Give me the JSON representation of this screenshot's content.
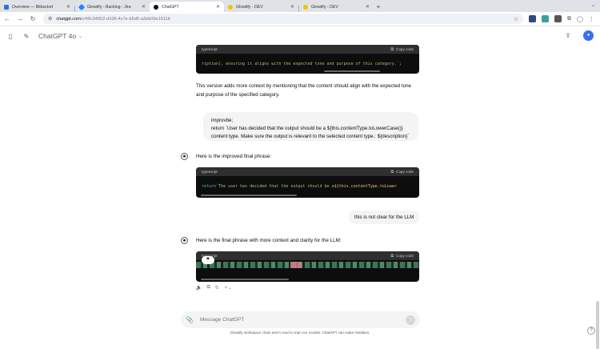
{
  "browser": {
    "tabs": [
      {
        "title": "Overview — Bitbucket",
        "color": "#2f6fe4"
      },
      {
        "title": "Glowtify - Backlog - Jira",
        "color": "#2684ff"
      },
      {
        "title": "ChatGPT",
        "color": "#111111"
      },
      {
        "title": "Glowtify - DEV",
        "color": "#f2c200"
      },
      {
        "title": "Glowtify - DEV",
        "color": "#f2c200"
      }
    ],
    "url_host": "chatgpt.com",
    "url_path": "/c/46c34052-d106-4c7e-b5d5-a3eb09e1511b"
  },
  "app": {
    "model": "ChatGPT 4o"
  },
  "conversation": {
    "code1": {
      "lang": "typescript",
      "copy_label": "Copy code",
      "line": "ription), ensuring it aligns with the expected tone and purpose of this category.`;"
    },
    "para1": "This version adds more context by mentioning that the content should align with the expected tone and purpose of the specified category.",
    "user1": {
      "line1": "improvbe;",
      "line2": "return `User has decided that the output should be a ${this.contentType.toLowerCase()}",
      "line3": "content type. Make sure the output is relevant to the selected content type.: ${description}`"
    },
    "asst2": "Here is the improved final phrase:",
    "code2": {
      "lang": "typescript",
      "copy_label": "Copy code",
      "kw": "return",
      "str": " `The user has decided that the output should be a ",
      "interp": "${this.contentType.toLower"
    },
    "user2": "this is not clear for the LLM",
    "asst3": "Here is the final phrase with more context and clarity for the LLM:",
    "code3": {
      "lang": "typescript",
      "copy_label": "Copy code"
    }
  },
  "composer": {
    "placeholder": "Message ChatGPT",
    "disclaimer": "Glowtify workspace chats aren't used to train our models. ChatGPT can make mistakes."
  }
}
